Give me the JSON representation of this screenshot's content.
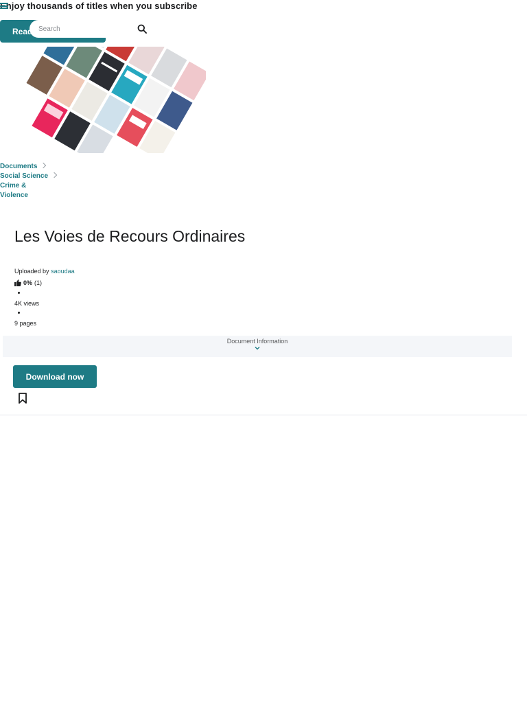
{
  "header": {
    "promo_text": "Enjoy thousands of titles when you subscribe",
    "cta_label": "Read for free",
    "search_placeholder": "Search",
    "icons": [
      "menu-icon",
      "search-icon"
    ],
    "accent_color": "#1e7b85"
  },
  "collage": {
    "icon": "book-covers-image"
  },
  "breadcrumbs": [
    {
      "label": "Documents"
    },
    {
      "label": "Social Science"
    },
    {
      "label": "Crime & Violence"
    }
  ],
  "document": {
    "title": "Les Voies de Recours Ordinaires",
    "uploaded_by_label": "Uploaded by",
    "uploader": "saoudaa",
    "rating_percent": "0%",
    "rating_count": "(1)",
    "views": "4K views",
    "pages": "9 pages"
  },
  "info_section": {
    "label": "Document Information",
    "icon": "chevron-down-icon"
  },
  "actions": {
    "download_label": "Download now",
    "save_icon": "bookmark-icon"
  }
}
